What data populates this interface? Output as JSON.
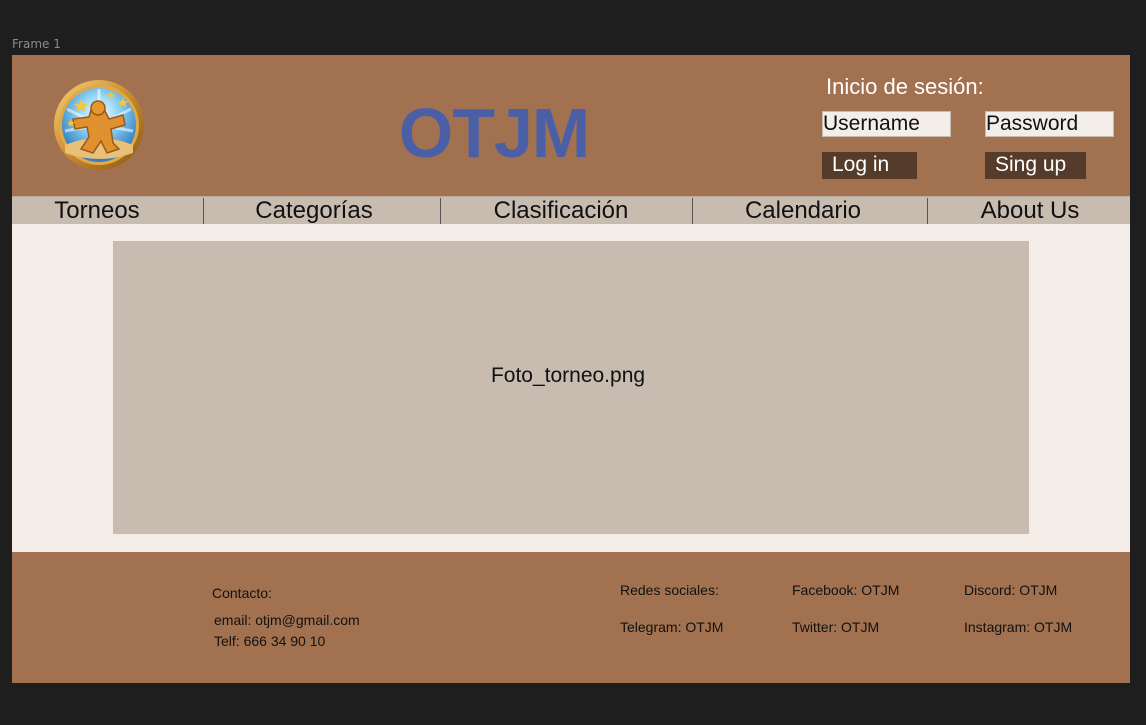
{
  "canvas": {
    "frame_label": "Frame 1"
  },
  "header": {
    "logo_icon": "game-piece-medallion-icon",
    "title": "OTJM",
    "title_color": "#4a5fa6",
    "background": "#a27250"
  },
  "login": {
    "title": "Inicio de sesión:",
    "username_placeholder": "Username",
    "password_placeholder": "Password",
    "login_label": "Log in",
    "signup_label": "Sing up",
    "button_color": "#553b2a"
  },
  "nav": {
    "items": [
      {
        "label": "Torneos"
      },
      {
        "label": "Categorías"
      },
      {
        "label": "Clasificación"
      },
      {
        "label": "Calendario"
      },
      {
        "label": "About Us"
      }
    ]
  },
  "main": {
    "photo_placeholder": "Foto_torneo.png"
  },
  "footer": {
    "contact_title": "Contacto:",
    "email": "email: otjm@gmail.com",
    "phone": "Telf: 666 34 90 10",
    "social_title": "Redes sociales:",
    "telegram": "Telegram: OTJM",
    "facebook": "Facebook: OTJM",
    "twitter": "Twitter: OTJM",
    "discord": "Discord: OTJM",
    "instagram": "Instagram: OTJM"
  }
}
